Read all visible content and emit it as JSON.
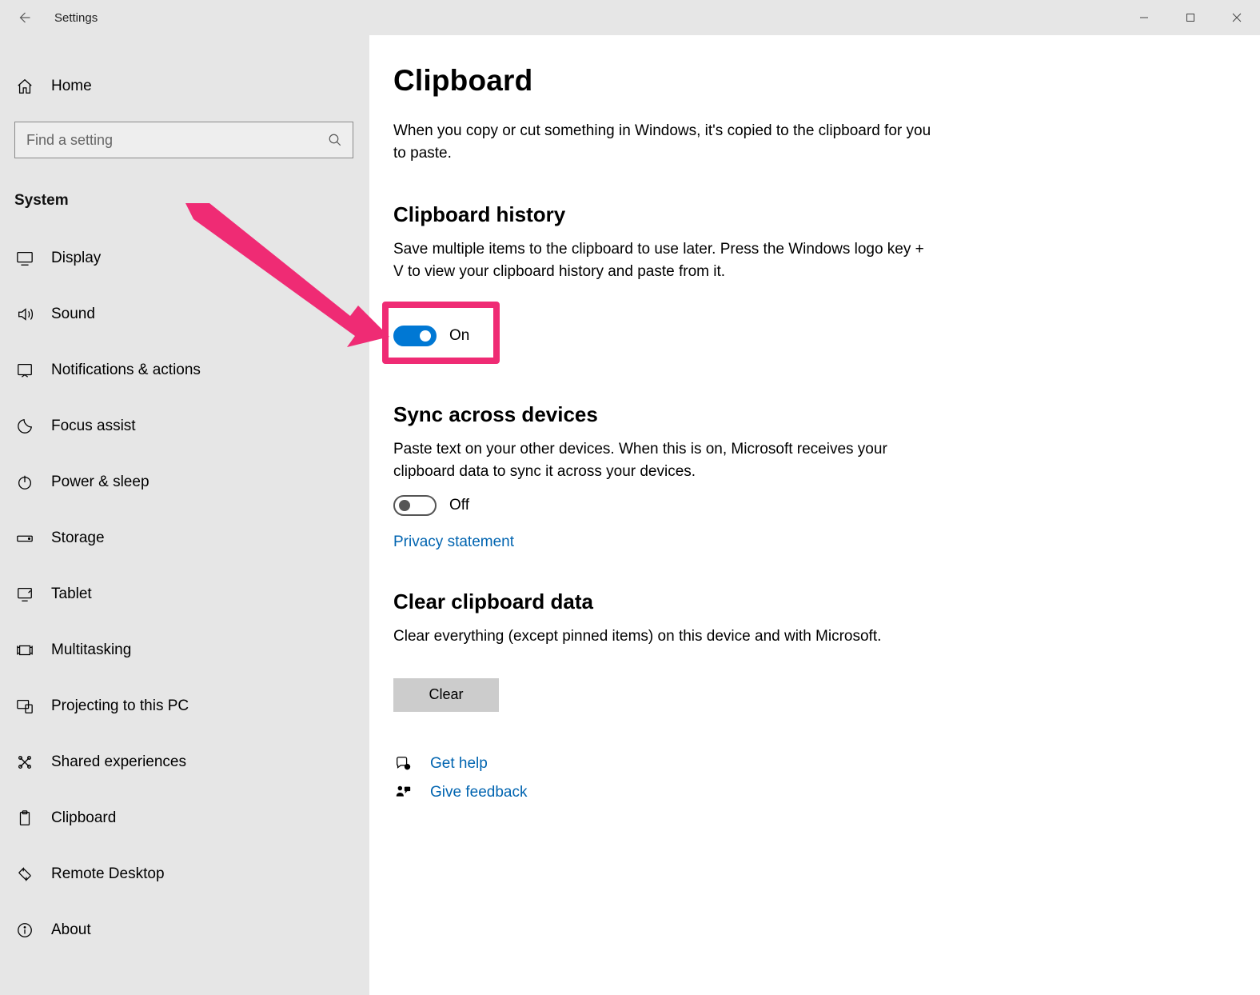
{
  "window": {
    "title": "Settings"
  },
  "sidebar": {
    "home": "Home",
    "search_placeholder": "Find a setting",
    "category": "System",
    "items": [
      {
        "id": "display",
        "label": "Display"
      },
      {
        "id": "sound",
        "label": "Sound"
      },
      {
        "id": "notifications",
        "label": "Notifications & actions"
      },
      {
        "id": "focus-assist",
        "label": "Focus assist"
      },
      {
        "id": "power-sleep",
        "label": "Power & sleep"
      },
      {
        "id": "storage",
        "label": "Storage"
      },
      {
        "id": "tablet",
        "label": "Tablet"
      },
      {
        "id": "multitasking",
        "label": "Multitasking"
      },
      {
        "id": "projecting",
        "label": "Projecting to this PC"
      },
      {
        "id": "shared-exp",
        "label": "Shared experiences"
      },
      {
        "id": "clipboard",
        "label": "Clipboard"
      },
      {
        "id": "remote-desktop",
        "label": "Remote Desktop"
      },
      {
        "id": "about",
        "label": "About"
      }
    ]
  },
  "main": {
    "title": "Clipboard",
    "intro": "When you copy or cut something in Windows, it's copied to the clipboard for you to paste.",
    "history": {
      "heading": "Clipboard history",
      "desc": "Save multiple items to the clipboard to use later. Press the Windows logo key + V to view your clipboard history and paste from it.",
      "toggle_state": "On"
    },
    "sync": {
      "heading": "Sync across devices",
      "desc": "Paste text on your other devices. When this is on, Microsoft receives your clipboard data to sync it across your devices.",
      "toggle_state": "Off",
      "privacy_link": "Privacy statement"
    },
    "clear": {
      "heading": "Clear clipboard data",
      "desc": "Clear everything (except pinned items) on this device and with Microsoft.",
      "button": "Clear"
    },
    "help": {
      "get_help": "Get help",
      "feedback": "Give feedback"
    }
  },
  "annotation": {
    "highlight_color": "#ef2b74"
  }
}
